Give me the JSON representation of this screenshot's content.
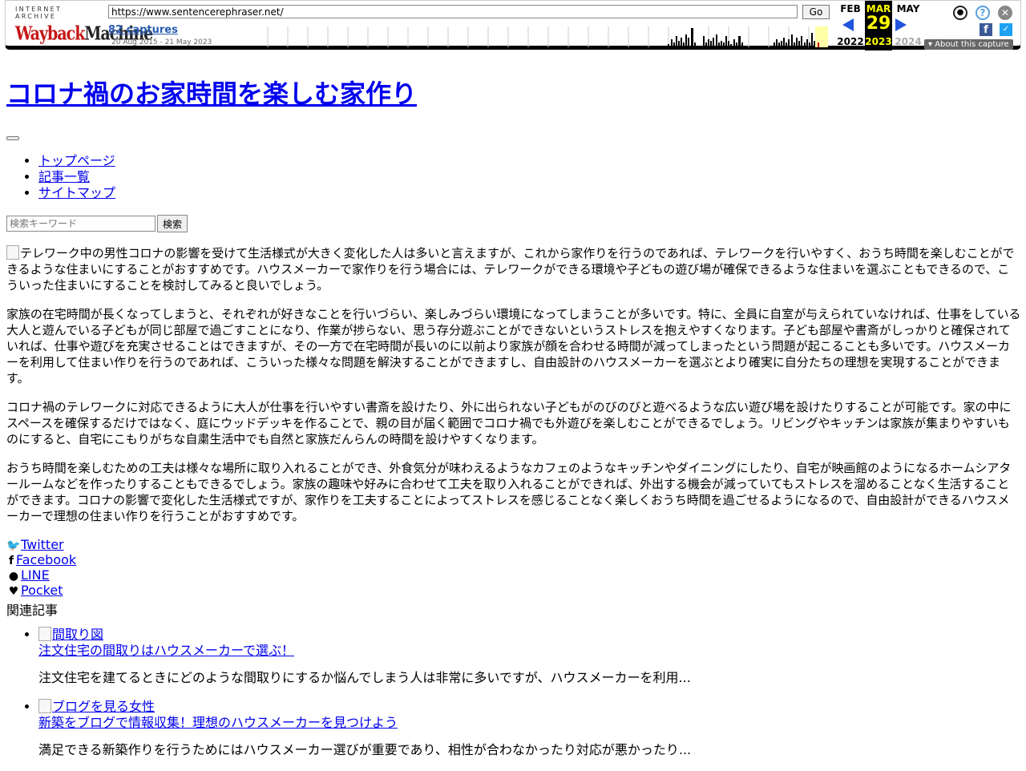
{
  "wayback": {
    "logo_top": "INTERNET ARCHIVE",
    "logo_main_1": "Wayback",
    "logo_main_2": "Machine",
    "url": "https://www.sentencerephraser.net/",
    "go_label": "Go",
    "captures": "82 captures",
    "range": "20 Aug 2015 - 21 May 2023",
    "prev_month": "FEB",
    "prev_year": "2022",
    "cur_month": "MAR",
    "cur_day": "29",
    "cur_year": "2023",
    "next_month": "MAY",
    "next_year": "2024",
    "about": "About this capture",
    "colors": {
      "accent": "#2255dd",
      "highlight": "#ffff00",
      "logo_red": "#c51515"
    }
  },
  "site": {
    "title": "コロナ禍のお家時間を楽しむ家作り",
    "nav": [
      "トップページ",
      "記事一覧",
      "サイトマップ"
    ],
    "search_placeholder": "検索キーワード",
    "search_button": "検索"
  },
  "article": {
    "image_alt": "テレワーク中の男性",
    "paragraphs": [
      "コロナの影響を受けて生活様式が大きく変化した人は多いと言えますが、これから家作りを行うのであれば、テレワークを行いやすく、おうち時間を楽しむことができるような住まいにすることがおすすめです。ハウスメーカーで家作りを行う場合には、テレワークができる環境や子どもの遊び場が確保できるような住まいを選ぶこともできるので、こういった住まいにすることを検討してみると良いでしょう。",
      "家族の在宅時間が長くなってしまうと、それぞれが好きなことを行いづらい、楽しみづらい環境になってしまうことが多いです。特に、全員に自室が与えられていなければ、仕事をしている大人と遊んでいる子どもが同じ部屋で過ごすことになり、作業が捗らない、思う存分遊ぶことができないというストレスを抱えやすくなります。子ども部屋や書斎がしっかりと確保されていれば、仕事や遊びを充実させることはできますが、その一方で在宅時間が長いのに以前より家族が顔を合わせる時間が減ってしまったという問題が起こることも多いです。ハウスメーカーを利用して住まい作りを行うのであれば、こういった様々な問題を解決することができますし、自由設計のハウスメーカーを選ぶとより確実に自分たちの理想を実現することができます。",
      "コロナ禍のテレワークに対応できるように大人が仕事を行いやすい書斎を設けたり、外に出られない子どもがのびのびと遊べるような広い遊び場を設けたりすることが可能です。家の中にスペースを確保するだけではなく、庭にウッドデッキを作ることで、親の目が届く範囲でコロナ禍でも外遊びを楽しむことができるでしょう。リビングやキッチンは家族が集まりやすいものにすると、自宅にこもりがちな自粛生活中でも自然と家族だんらんの時間を設けやすくなります。",
      "おうち時間を楽しむための工夫は様々な場所に取り入れることができ、外食気分が味わえるようなカフェのようなキッチンやダイニングにしたり、自宅が映画館のようになるホームシアタールームなどを作ったりすることもできるでしょう。家族の趣味や好みに合わせて工夫を取り入れることができれば、外出する機会が減っていてもストレスを溜めることなく生活することができます。コロナの影響で変化した生活様式ですが、家作りを工夫することによってストレスを感じることなく楽しくおうち時間を過ごせるようになるので、自由設計ができるハウスメーカーで理想の住まい作りを行うことがおすすめです。"
    ]
  },
  "share": {
    "twitter": "Twitter",
    "facebook": "Facebook",
    "line": "LINE",
    "pocket": "Pocket"
  },
  "related": {
    "heading": "関連記事",
    "items": [
      {
        "image_alt": "間取り図",
        "title": "注文住宅の間取りはハウスメーカーで選ぶ！",
        "excerpt": "注文住宅を建てるときにどのような間取りにするか悩んでしまう人は非常に多いですが、ハウスメーカーを利用..."
      },
      {
        "image_alt": "ブログを見る女性",
        "title": "新築をブログで情報収集！理想のハウスメーカーを見つけよう",
        "excerpt": "満足できる新築作りを行うためにはハウスメーカー選びが重要であり、相性が合わなかったり対応が悪かったり..."
      }
    ]
  }
}
